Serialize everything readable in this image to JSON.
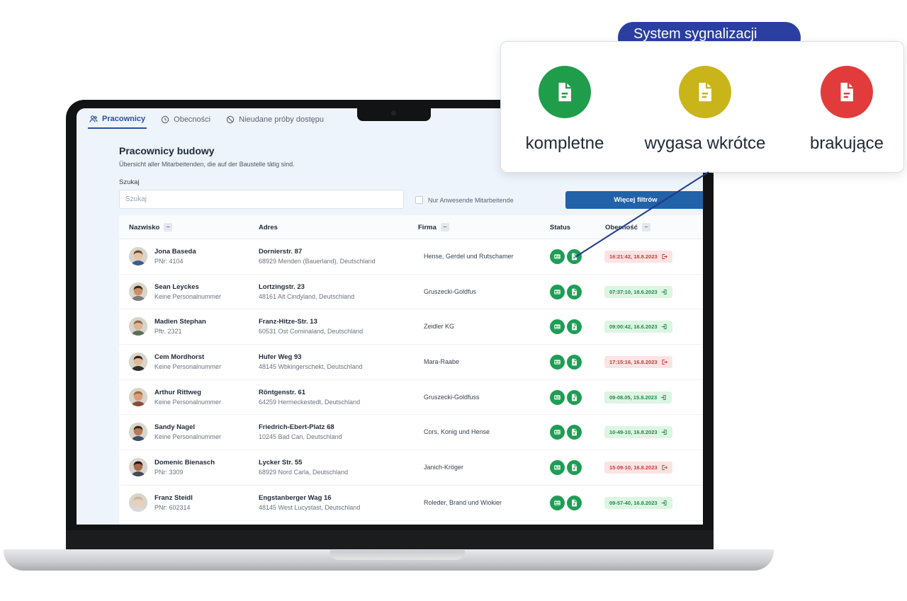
{
  "callout": {
    "title": "System sygnalizacji",
    "legend": [
      {
        "label": "kompletne",
        "color": "#1f9d4a"
      },
      {
        "label": "wygasa wkrótce",
        "color": "#c9b51a"
      },
      {
        "label": "brakujące",
        "color": "#e23b3b"
      }
    ]
  },
  "tabs": [
    {
      "label": "Pracownicy",
      "icon": "users-icon"
    },
    {
      "label": "Obecności",
      "icon": "clock-icon"
    },
    {
      "label": "Nieudane próby dostępu",
      "icon": "blocked-icon"
    }
  ],
  "page": {
    "title": "Pracownicy budowy",
    "subtitle": "Übersicht aller Mitarbeitenden, die auf der Baustelle tätig sind.",
    "search_label": "Szukaj",
    "search_placeholder": "Szukaj",
    "checkbox_label": "Nur Anwesende Mitarbeitende",
    "filters_button": "Więcej filtrów"
  },
  "table": {
    "columns": [
      "Nazwisko",
      "Adres",
      "Firma",
      "Status",
      "Obecność"
    ],
    "rows": [
      {
        "name": "Jona Baseda",
        "pnr": "PNr: 4104",
        "street": "Dornierstr. 87",
        "city": "68929 Menden (Bauerland), Deutschland",
        "company": "Hense, Gerdel und Rutschamer",
        "presence": "16:21:42, 18.8.2023",
        "presence_state": "out"
      },
      {
        "name": "Sean Leyckes",
        "pnr": "Keine Personalnummer",
        "street": "Lortzingstr. 23",
        "city": "48161 Alt Cindyland, Deutschland",
        "company": "Gruszecki-Goldfus",
        "presence": "07:37:10, 18.6.2023",
        "presence_state": "in"
      },
      {
        "name": "Madien Stephan",
        "pnr": "Pftr. 2321",
        "street": "Franz-Hitze-Str. 13",
        "city": "60531 Ost Cominaland, Deutschland",
        "company": "Zeidler KG",
        "presence": "09:00:42, 16.6.2023",
        "presence_state": "in"
      },
      {
        "name": "Cem Mordhorst",
        "pnr": "Keine Personalnummer",
        "street": "Hufer Weg 93",
        "city": "48145 Wbkingerschekt, Deutschland",
        "company": "Mara-Raabe",
        "presence": "17:15:16, 16.8.2023",
        "presence_state": "out"
      },
      {
        "name": "Arthur Rittweg",
        "pnr": "Keine Personalnummer",
        "street": "Röntgenstr. 61",
        "city": "64259 Hermeckestedt, Deutschland",
        "company": "Gruszecki-Goldfuss",
        "presence": "09-08.05, 15.8.2023",
        "presence_state": "in"
      },
      {
        "name": "Sandy Nagel",
        "pnr": "Keine Personalnummer",
        "street": "Friedrich-Ebert-Platz 68",
        "city": "10245 Bad Can, Deutschland",
        "company": "Cors, Konig und Hense",
        "presence": "10-49-10, 16.8.2023",
        "presence_state": "in"
      },
      {
        "name": "Domenic Bienasch",
        "pnr": "PNr: 3309",
        "street": "Lycker Str. 55",
        "city": "68929 Nord Carla, Deutschland",
        "company": "Janich-Kröger",
        "presence": "15-09-10, 16.8.2023",
        "presence_state": "out"
      },
      {
        "name": "Franz Steidl",
        "pnr": "PNr: 602314",
        "street": "Engstanberger Wag 16",
        "city": "48145 West Lucystast, Deutschland",
        "company": "Roleder, Brand und Wiokier",
        "presence": "09-57-40, 16.8.2023",
        "presence_state": "in"
      }
    ]
  },
  "colors": {
    "accent": "#2c4f9e",
    "button": "#2162a8",
    "status_green": "#1f9d55",
    "presence_in": "#24894a",
    "presence_out": "#c43b3b"
  }
}
